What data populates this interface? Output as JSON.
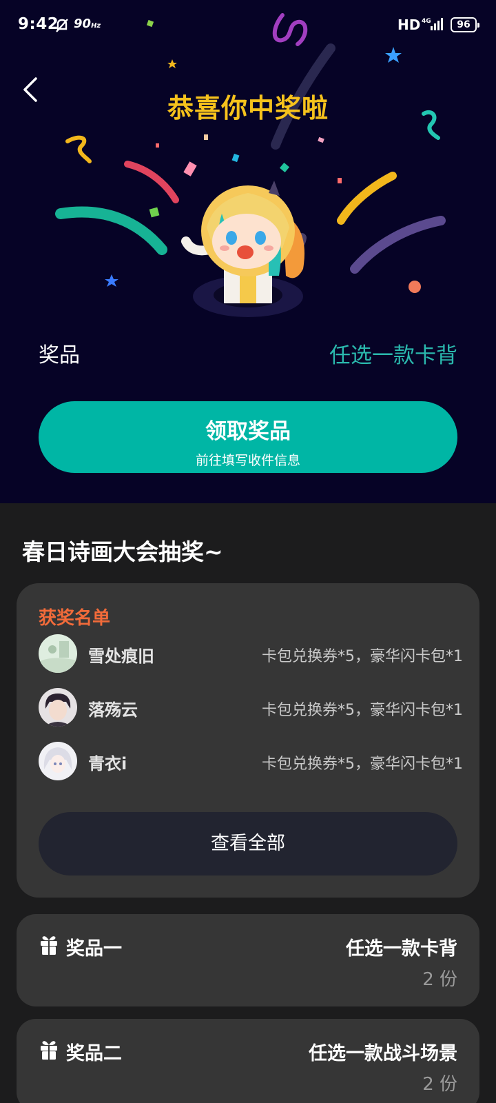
{
  "status_bar": {
    "time": "9:42",
    "refresh": "90",
    "refresh_unit": "Hz",
    "network": "HD",
    "signal": "4G",
    "battery": "96"
  },
  "hero": {
    "title": "恭喜你中奖啦",
    "prize_label": "奖品",
    "prize_value": "任选一款卡背",
    "claim_button": {
      "label": "领取奖品",
      "sublabel": "前往填写收件信息"
    }
  },
  "event": {
    "title": "春日诗画大会抽奖~"
  },
  "winners": {
    "title": "获奖名单",
    "items": [
      {
        "name": "雪处痕旧",
        "prize": "卡包兑换券*5，豪华闪卡包*1"
      },
      {
        "name": "落殇云",
        "prize": "卡包兑换券*5，豪华闪卡包*1"
      },
      {
        "name": "青衣i",
        "prize": "卡包兑换券*5，豪华闪卡包*1"
      }
    ],
    "view_all": "查看全部"
  },
  "prizes": [
    {
      "name": "奖品一",
      "value": "任选一款卡背",
      "count": "2 份"
    },
    {
      "name": "奖品二",
      "value": "任选一款战斗场景",
      "count": "2 份"
    }
  ],
  "colors": {
    "hero_bg": "#060326",
    "title": "#f6c21c",
    "accent": "#00b6a5",
    "prize_text": "#2ab8ad",
    "winners_title": "#f26b3a",
    "card_bg": "#363636",
    "page_bg": "#1c1c1d"
  }
}
